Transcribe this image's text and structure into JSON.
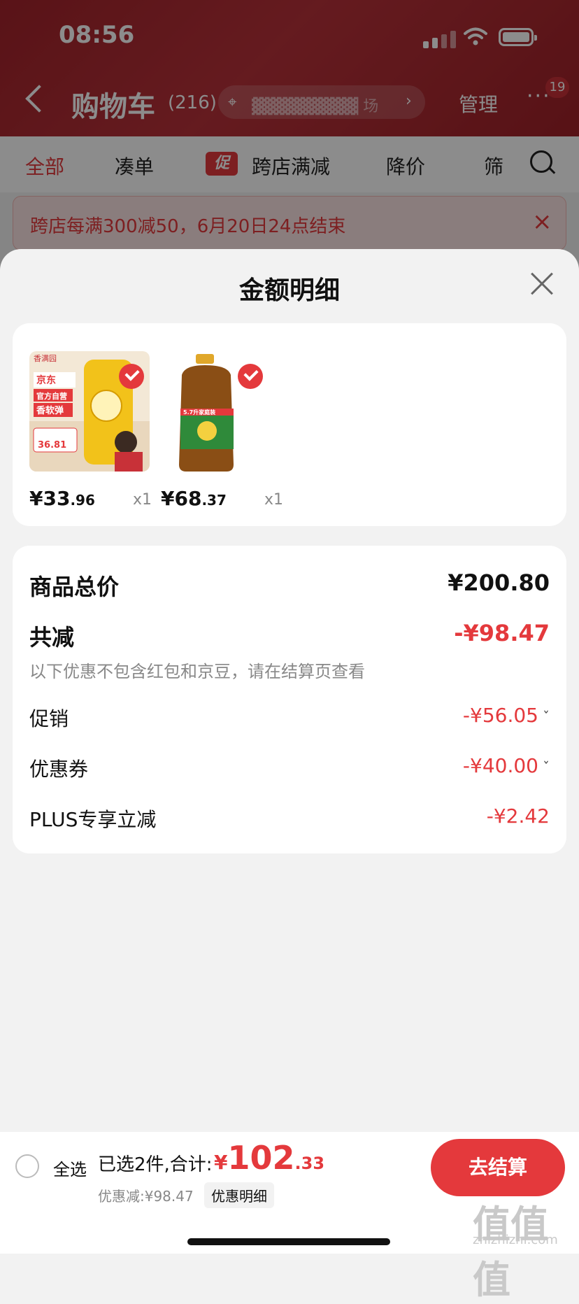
{
  "status": {
    "time": "08:56"
  },
  "nav": {
    "title": "购物车",
    "count": "(216)",
    "address_text": "▓▓▓▓▓▓▓▓▓ 场",
    "manage": "管理",
    "more": "···",
    "badge": "19"
  },
  "tabs": [
    {
      "label": "全部"
    },
    {
      "label": "凑单"
    },
    {
      "tag": "促",
      "label": "跨店满减"
    },
    {
      "label": "降价"
    },
    {
      "label": "筛"
    }
  ],
  "notice": "跨店每满300减50，6月20日24点结束",
  "sheet": {
    "title": "金额明细",
    "products": [
      {
        "price_int": "¥33",
        "price_dec": ".96",
        "qty": "x1"
      },
      {
        "price_int": "¥68",
        "price_dec": ".37",
        "qty": "x1"
      }
    ],
    "product1_img": {
      "brand": "香满园",
      "shop": "京东",
      "tag1": "官方自营",
      "tag2": "香软弹",
      "price": "36.81"
    },
    "product2_img": {
      "label": "5.7升家庭装"
    },
    "summary": {
      "total_label": "商品总价",
      "total_value": "¥200.80",
      "discount_label": "共减",
      "discount_value": "-¥98.47",
      "note": "以下优惠不包含红包和京豆，请在结算页查看",
      "items": [
        {
          "label": "促销",
          "value": "-¥56.05",
          "chev": "ˇ"
        },
        {
          "label": "优惠券",
          "value": "-¥40.00",
          "chev": "ˇ"
        },
        {
          "label": "PLUS专享立减",
          "value": "-¥2.42"
        }
      ]
    }
  },
  "bottom": {
    "select_all": "全选",
    "selected": "已选2件,合计:",
    "total_sym": "¥",
    "total_int": "102",
    "total_dec": ".33",
    "saved": "优惠减:¥98.47",
    "detail_btn": "优惠明细",
    "checkout": "去结算"
  },
  "watermark": {
    "main": "值值值",
    "sub": "zhizhizhi.com"
  },
  "colors": {
    "accent": "#e4393c",
    "header": "#a3232b"
  }
}
